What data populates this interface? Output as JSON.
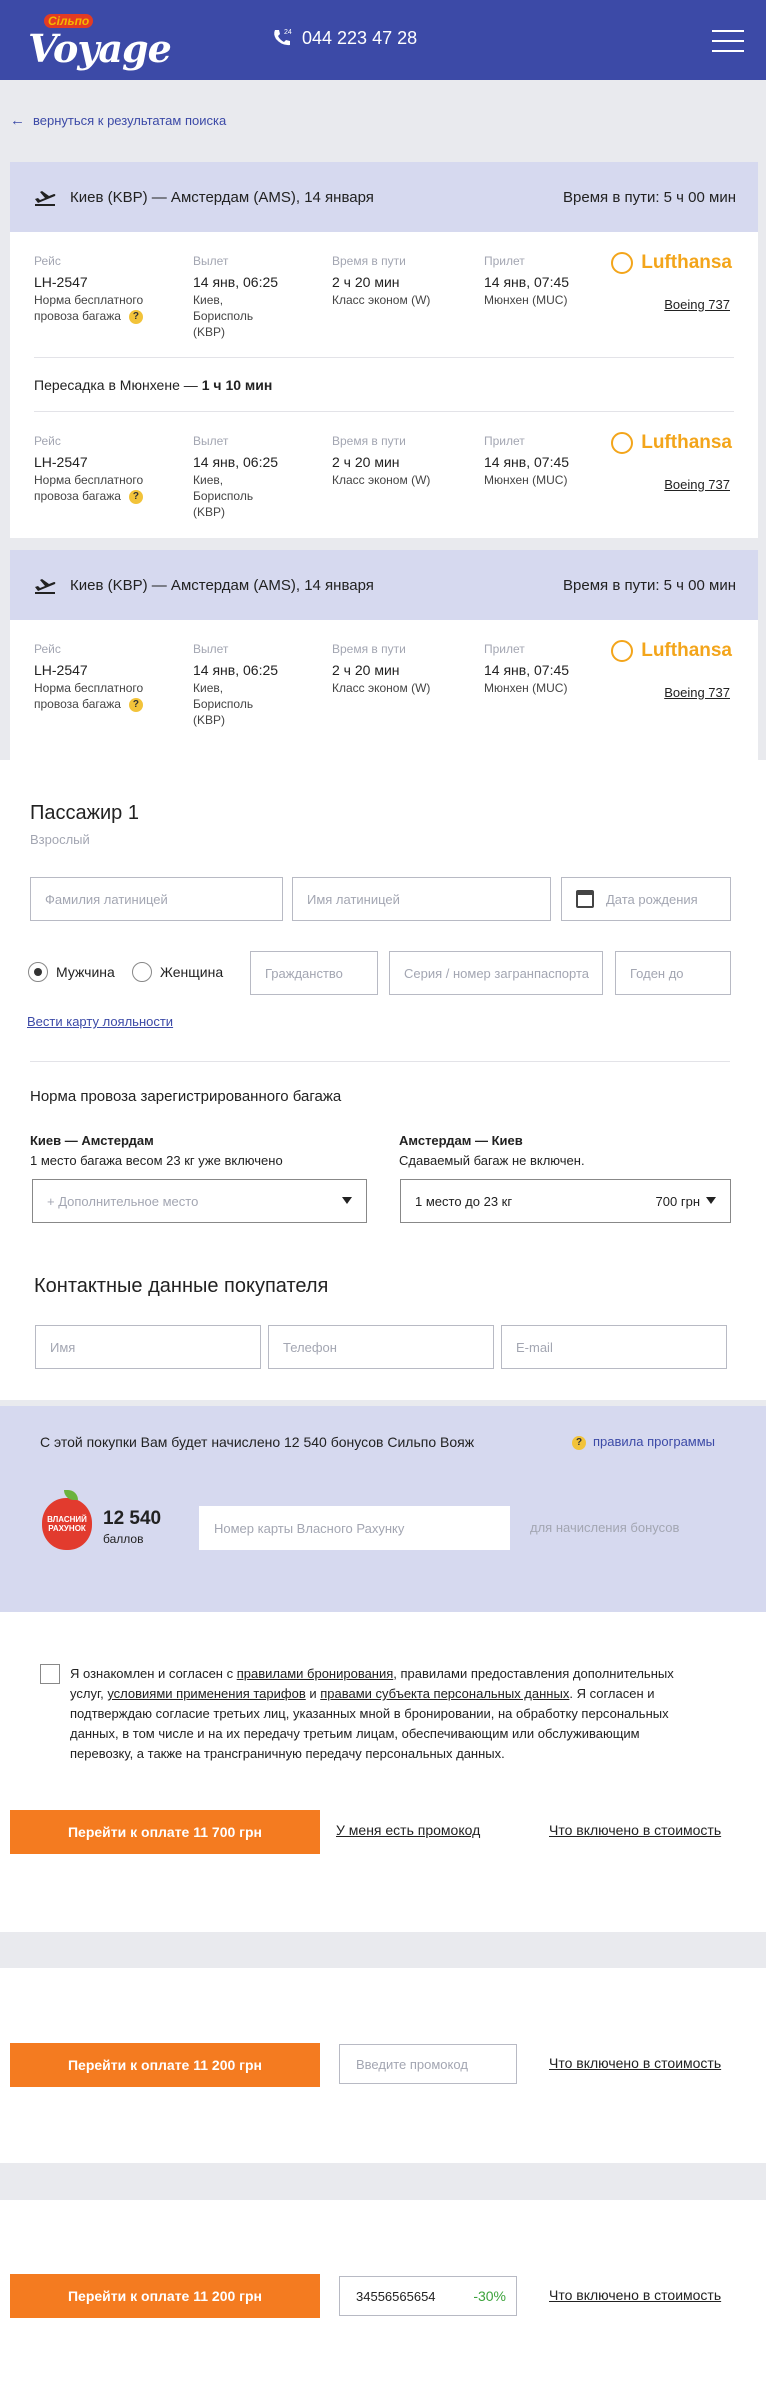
{
  "header": {
    "logo_sub": "Сільпо",
    "logo_text": "Voyage",
    "phone_badge": "24",
    "phone": "044 223 47 28"
  },
  "back_link": "вернуться к результатам поиска",
  "segments": [
    {
      "route": "Киев (KBP) — Амстердам (AMS), 14 января",
      "duration": "Время в пути: 5 ч 00 мин",
      "flights": [
        {
          "flight_label": "Рейс",
          "flight": "LH-2547",
          "baggage": "Норма бесплатного провоза багажа",
          "dep_label": "Вылет",
          "dep_time": "14 янв, 06:25",
          "dep_place": "Киев, Борисполь (KBP)",
          "dur_label": "Время в пути",
          "dur": "2 ч 20 мин",
          "class": "Класс эконом (W)",
          "arr_label": "Прилет",
          "arr_time": "14 янв, 07:45",
          "arr_place": "Мюнхен (MUC)",
          "airline": "Lufthansa",
          "aircraft": "Boeing 737"
        },
        {
          "flight_label": "Рейс",
          "flight": "LH-2547",
          "baggage": "Норма бесплатного провоза багажа",
          "dep_label": "Вылет",
          "dep_time": "14 янв, 06:25",
          "dep_place": "Киев, Борисполь (KBP)",
          "dur_label": "Время в пути",
          "dur": "2 ч 20 мин",
          "class": "Класс эконом (W)",
          "arr_label": "Прилет",
          "arr_time": "14 янв, 07:45",
          "arr_place": "Мюнхен (MUC)",
          "airline": "Lufthansa",
          "aircraft": "Boeing 737"
        }
      ],
      "transfer": "Пересадка в Мюнхене —",
      "transfer_time": "1 ч 10 мин"
    },
    {
      "route": "Киев (KBP) — Амстердам (AMS), 14 января",
      "duration": "Время в пути: 5 ч 00 мин",
      "flights": [
        {
          "flight_label": "Рейс",
          "flight": "LH-2547",
          "baggage": "Норма бесплатного провоза багажа",
          "dep_label": "Вылет",
          "dep_time": "14 янв, 06:25",
          "dep_place": "Киев, Борисполь (KBP)",
          "dur_label": "Время в пути",
          "dur": "2 ч 20 мин",
          "class": "Класс эконом (W)",
          "arr_label": "Прилет",
          "arr_time": "14 янв, 07:45",
          "arr_place": "Мюнхен (MUC)",
          "airline": "Lufthansa",
          "aircraft": "Boeing 737"
        }
      ]
    }
  ],
  "passenger": {
    "title": "Пассажир 1",
    "type": "Взрослый",
    "surname_ph": "Фамилия латиницей",
    "name_ph": "Имя латиницей",
    "birth_ph": "Дата рождения",
    "male": "Мужчина",
    "female": "Женщина",
    "citizenship_ph": "Гражданство",
    "passport_ph": "Серия / номер загранпаспорта",
    "valid_ph": "Годен до",
    "loyalty_link": "Вести карту лояльности"
  },
  "baggage": {
    "title": "Норма провоза зарегистрированного багажа",
    "left_route": "Киев — Амстердам",
    "left_info": "1 место багажа весом 23 кг уже включено",
    "left_select": "+ Дополнительное место",
    "right_route": "Амстердам — Киев",
    "right_info": "Сдаваемый багаж не включен.",
    "right_select": "1 место до 23 кг",
    "right_price": "700 грн"
  },
  "contact": {
    "title": "Контактные данные покупателя",
    "name_ph": "Имя",
    "phone_ph": "Телефон",
    "email_ph": "E-mail"
  },
  "bonus": {
    "text": "С этой покупки Вам будет начислено 12 540 бонусов Сильпо Вояж",
    "rules_link": "правила программы",
    "card_logo_text": "ВЛАСНИЙ РАХУНОК",
    "points": "12 540",
    "points_unit": "баллов",
    "card_ph": "Номер карты Власного Рахунку",
    "hint": "для начисления бонусов"
  },
  "agreement": {
    "t1": "Я ознакомлен и согласен с ",
    "l1": "правилами бронирования",
    "t2": ", правилами предоставления дополнительных услуг, ",
    "l2": "условиями применения тарифов",
    "t3": " и ",
    "l3": "правами субъекта персональных данных",
    "t4": ". Я согласен и подтверждаю согласие третьих лиц, указанных мной в бронировании, на обработку персональных данных, в том числе и на их передачу третьим лицам, обеспечивающим или обслуживающим перевозку, а также на трансграничную передачу персональных данных."
  },
  "pay1": {
    "button": "Перейти к оплате 11 700 грн",
    "promo_link": "У меня есть промокод",
    "included": "Что включено в стоимость"
  },
  "pay2": {
    "button": "Перейти к оплате 11 200 грн",
    "promo_ph": "Введите промокод",
    "included": "Что включено в стоимость"
  },
  "pay3": {
    "button": "Перейти к оплате 11 200 грн",
    "promo_value": "34556565654",
    "discount": "-30%",
    "included": "Что включено в стоимость"
  },
  "colors": {
    "brand": "#3c4aa7",
    "accent": "#f47b20",
    "airline": "#f3a51b",
    "panel": "#d6d9ef"
  }
}
